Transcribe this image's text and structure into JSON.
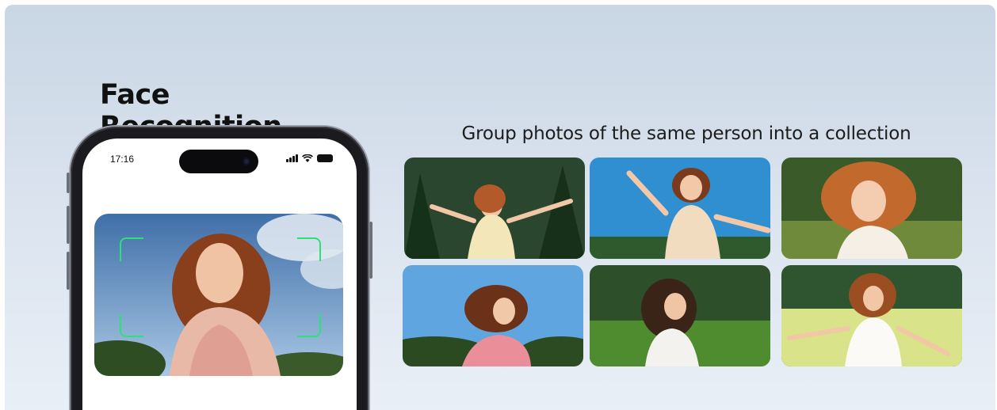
{
  "title": "Face Recognition",
  "subtitle": "Group photos of the same person into a collection",
  "phone": {
    "status_time": "17:16",
    "status_icons": [
      "signal-icon",
      "wifi-icon",
      "battery-icon"
    ]
  },
  "colors": {
    "banner_top": "#c9d6e4",
    "banner_bottom": "#e9eff6",
    "face_frame": "#2ee07a",
    "phone_body": "#1b1b1f"
  },
  "collection": {
    "photos": [
      {
        "name": "photo-forest-arms-raised"
      },
      {
        "name": "photo-blue-sky-fist-raised"
      },
      {
        "name": "photo-sunlit-hair-flowing"
      },
      {
        "name": "photo-running-profile"
      },
      {
        "name": "photo-meadow-running"
      },
      {
        "name": "photo-meadow-arms-out"
      }
    ]
  }
}
